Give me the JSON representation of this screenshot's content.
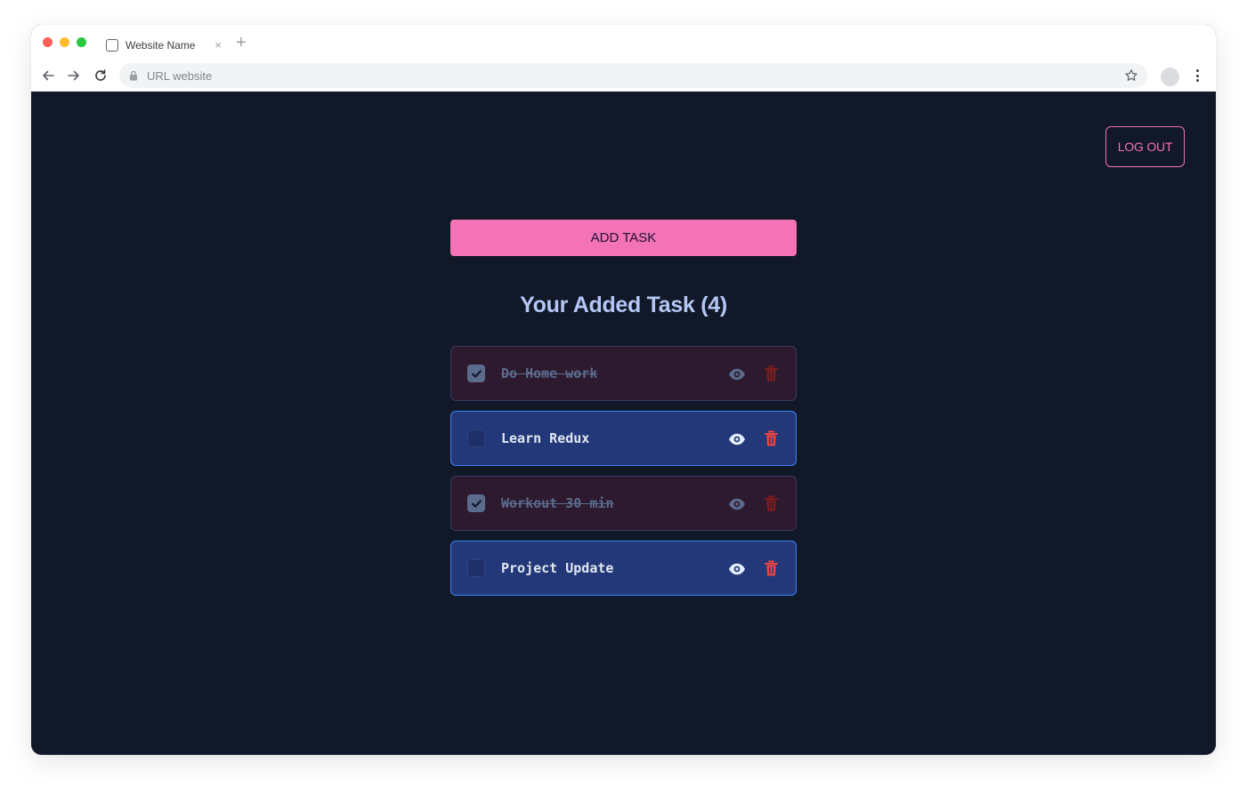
{
  "browser": {
    "tab_title": "Website Name",
    "tab_close": "×",
    "new_tab": "+",
    "url": "URL website"
  },
  "header": {
    "logout_label": "LOG OUT"
  },
  "main": {
    "add_task_label": "ADD TASK",
    "list_title": "Your Added Task (4)",
    "tasks": [
      {
        "label": "Do Home work",
        "completed": true
      },
      {
        "label": "Learn Redux",
        "completed": false
      },
      {
        "label": "Workout 30 min",
        "completed": true
      },
      {
        "label": "Project Update",
        "completed": false
      }
    ]
  },
  "colors": {
    "page_bg": "#111827",
    "accent_pink": "#f472b6",
    "title_blue": "#b4c6f5",
    "task_open_bg": "#233878",
    "task_done_bg": "#2d1a2e",
    "delete_red": "#ef4444"
  },
  "icons": [
    "page-icon",
    "close-icon",
    "plus-icon",
    "back-arrow-icon",
    "forward-arrow-icon",
    "reload-icon",
    "lock-icon",
    "star-icon",
    "avatar",
    "kebab-menu-icon",
    "check-icon",
    "eye-icon",
    "trash-icon"
  ]
}
